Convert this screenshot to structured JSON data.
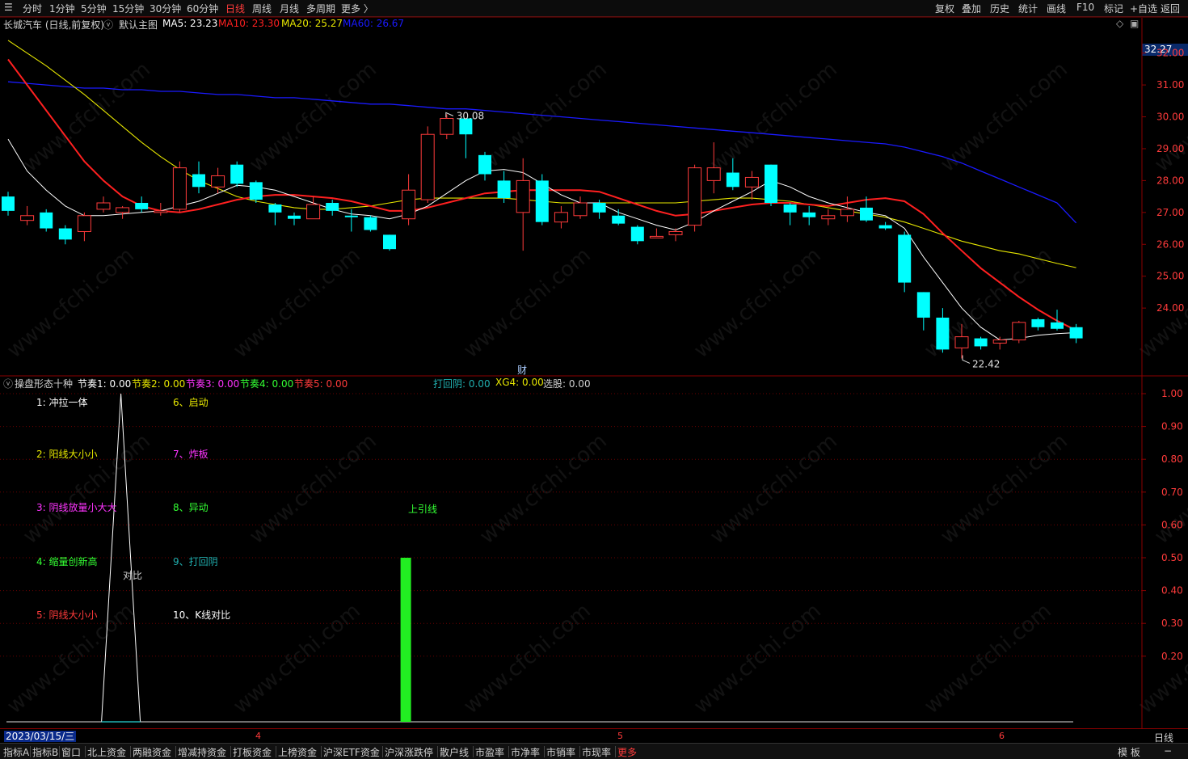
{
  "topbar": {
    "periods": [
      "分时",
      "1分钟",
      "5分钟",
      "15分钟",
      "30分钟",
      "60分钟",
      "日线",
      "周线",
      "月线",
      "多周期",
      "更多 〉"
    ],
    "active_period": "日线",
    "right_buttons": [
      "复权",
      "叠加",
      "历史",
      "统计",
      "画线",
      "F10",
      "标记",
      "+自选",
      "返回"
    ]
  },
  "main_info": {
    "stock": "长城汽车 (日线,前复权)",
    "template": "默认主图",
    "ma5": "MA5: 23.23",
    "ma10": "MA10: 23.30",
    "ma20": "MA20: 25.27",
    "ma60": "MA60: 26.67"
  },
  "colors": {
    "up": "#ff3b3b",
    "down": "#00ffff",
    "ma5": "#ffffff",
    "ma10": "#ff2020",
    "ma20": "#e6e600",
    "ma60": "#1a1aff",
    "axis": "#8b0000"
  },
  "price_axis": {
    "current": "32.27",
    "ticks": [
      "32.00",
      "31.00",
      "30.00",
      "29.00",
      "28.00",
      "27.00",
      "26.00",
      "25.00",
      "24.00"
    ]
  },
  "annotations": {
    "high": "30.08",
    "low": "22.42",
    "event_marker": "财"
  },
  "chart_data": {
    "type": "candlestick",
    "x_labels": [
      "4",
      "5",
      "6"
    ],
    "ylim": [
      22.0,
      32.6
    ],
    "candles": [
      {
        "o": 27.5,
        "c": 27.05,
        "h": 27.65,
        "l": 26.9
      },
      {
        "o": 26.75,
        "c": 26.9,
        "h": 27.2,
        "l": 26.6
      },
      {
        "o": 27.0,
        "c": 26.5,
        "h": 27.1,
        "l": 26.4
      },
      {
        "o": 26.5,
        "c": 26.15,
        "h": 26.6,
        "l": 26.0
      },
      {
        "o": 26.4,
        "c": 26.9,
        "h": 27.0,
        "l": 26.1
      },
      {
        "o": 27.1,
        "c": 27.3,
        "h": 27.5,
        "l": 27.0
      },
      {
        "o": 27.0,
        "c": 27.15,
        "h": 27.2,
        "l": 26.8
      },
      {
        "o": 27.3,
        "c": 27.1,
        "h": 27.5,
        "l": 27.0
      },
      {
        "o": 27.0,
        "c": 27.05,
        "h": 27.3,
        "l": 26.9
      },
      {
        "o": 27.1,
        "c": 28.4,
        "h": 28.6,
        "l": 27.0
      },
      {
        "o": 28.2,
        "c": 27.8,
        "h": 28.6,
        "l": 27.6
      },
      {
        "o": 27.8,
        "c": 28.15,
        "h": 28.4,
        "l": 27.6
      },
      {
        "o": 28.5,
        "c": 27.9,
        "h": 28.6,
        "l": 27.8
      },
      {
        "o": 27.95,
        "c": 27.4,
        "h": 28.0,
        "l": 27.3
      },
      {
        "o": 27.25,
        "c": 27.0,
        "h": 27.3,
        "l": 26.6
      },
      {
        "o": 26.9,
        "c": 26.8,
        "h": 27.0,
        "l": 26.6
      },
      {
        "o": 26.8,
        "c": 27.25,
        "h": 27.5,
        "l": 26.8
      },
      {
        "o": 27.3,
        "c": 27.05,
        "h": 27.4,
        "l": 26.9
      },
      {
        "o": 26.9,
        "c": 26.85,
        "h": 27.1,
        "l": 26.4
      },
      {
        "o": 26.85,
        "c": 26.45,
        "h": 26.9,
        "l": 26.4
      },
      {
        "o": 26.3,
        "c": 25.85,
        "h": 26.3,
        "l": 25.8
      },
      {
        "o": 26.8,
        "c": 27.7,
        "h": 28.2,
        "l": 26.6
      },
      {
        "o": 27.4,
        "c": 29.45,
        "h": 29.7,
        "l": 27.3
      },
      {
        "o": 29.45,
        "c": 29.95,
        "h": 30.08,
        "l": 29.3
      },
      {
        "o": 29.95,
        "c": 29.45,
        "h": 29.95,
        "l": 28.7
      },
      {
        "o": 28.8,
        "c": 28.2,
        "h": 28.9,
        "l": 28.0
      },
      {
        "o": 28.0,
        "c": 27.45,
        "h": 28.3,
        "l": 27.3
      },
      {
        "o": 27.0,
        "c": 28.0,
        "h": 28.7,
        "l": 25.8
      },
      {
        "o": 28.0,
        "c": 26.7,
        "h": 28.2,
        "l": 26.6
      },
      {
        "o": 26.7,
        "c": 27.0,
        "h": 27.2,
        "l": 26.5
      },
      {
        "o": 26.9,
        "c": 27.3,
        "h": 27.5,
        "l": 26.8
      },
      {
        "o": 27.3,
        "c": 27.0,
        "h": 27.4,
        "l": 26.8
      },
      {
        "o": 26.9,
        "c": 26.65,
        "h": 27.1,
        "l": 26.6
      },
      {
        "o": 26.55,
        "c": 26.1,
        "h": 26.6,
        "l": 26.0
      },
      {
        "o": 26.2,
        "c": 26.25,
        "h": 26.5,
        "l": 26.2
      },
      {
        "o": 26.3,
        "c": 26.4,
        "h": 26.5,
        "l": 26.1
      },
      {
        "o": 26.6,
        "c": 28.4,
        "h": 28.5,
        "l": 26.4
      },
      {
        "o": 28.0,
        "c": 28.4,
        "h": 29.2,
        "l": 27.6
      },
      {
        "o": 28.25,
        "c": 27.8,
        "h": 28.7,
        "l": 27.7
      },
      {
        "o": 27.8,
        "c": 28.1,
        "h": 28.3,
        "l": 27.4
      },
      {
        "o": 28.5,
        "c": 27.3,
        "h": 28.5,
        "l": 27.2
      },
      {
        "o": 27.25,
        "c": 27.0,
        "h": 27.3,
        "l": 26.6
      },
      {
        "o": 27.0,
        "c": 26.85,
        "h": 27.2,
        "l": 26.6
      },
      {
        "o": 26.8,
        "c": 26.9,
        "h": 27.1,
        "l": 26.6
      },
      {
        "o": 26.9,
        "c": 27.1,
        "h": 27.5,
        "l": 26.7
      },
      {
        "o": 27.15,
        "c": 26.75,
        "h": 27.5,
        "l": 26.7
      },
      {
        "o": 26.6,
        "c": 26.5,
        "h": 26.7,
        "l": 26.45
      },
      {
        "o": 26.3,
        "c": 24.8,
        "h": 26.4,
        "l": 24.5
      },
      {
        "o": 24.5,
        "c": 23.7,
        "h": 24.5,
        "l": 23.3
      },
      {
        "o": 23.7,
        "c": 22.7,
        "h": 24.0,
        "l": 22.6
      },
      {
        "o": 22.75,
        "c": 23.1,
        "h": 23.5,
        "l": 22.42
      },
      {
        "o": 23.05,
        "c": 22.8,
        "h": 23.1,
        "l": 22.7
      },
      {
        "o": 22.9,
        "c": 23.0,
        "h": 23.1,
        "l": 22.7
      },
      {
        "o": 23.0,
        "c": 23.55,
        "h": 23.6,
        "l": 22.9
      },
      {
        "o": 23.65,
        "c": 23.4,
        "h": 23.7,
        "l": 23.3
      },
      {
        "o": 23.55,
        "c": 23.35,
        "h": 23.95,
        "l": 23.3
      },
      {
        "o": 23.4,
        "c": 23.05,
        "h": 23.5,
        "l": 22.9
      }
    ],
    "ma5": [
      29.3,
      28.3,
      27.7,
      27.2,
      26.9,
      26.9,
      26.95,
      27.0,
      27.05,
      27.2,
      27.35,
      27.6,
      27.85,
      27.8,
      27.7,
      27.5,
      27.3,
      27.1,
      26.95,
      26.9,
      26.8,
      26.95,
      27.2,
      27.6,
      28.0,
      28.3,
      28.35,
      28.25,
      27.9,
      27.55,
      27.3,
      27.3,
      27.0,
      26.8,
      26.6,
      26.45,
      26.7,
      27.05,
      27.35,
      27.65,
      28.0,
      27.8,
      27.5,
      27.3,
      27.15,
      27.0,
      26.9,
      26.5,
      25.6,
      24.8,
      24.0,
      23.4,
      23.0,
      23.05,
      23.15,
      23.2,
      23.23
    ],
    "ma10": [
      31.8,
      31.0,
      30.2,
      29.4,
      28.6,
      28.0,
      27.5,
      27.2,
      27.05,
      27.0,
      27.1,
      27.25,
      27.4,
      27.5,
      27.55,
      27.55,
      27.5,
      27.45,
      27.35,
      27.2,
      27.05,
      27.05,
      27.15,
      27.3,
      27.45,
      27.6,
      27.65,
      27.7,
      27.7,
      27.7,
      27.7,
      27.65,
      27.45,
      27.25,
      27.05,
      26.9,
      26.95,
      27.05,
      27.15,
      27.25,
      27.3,
      27.3,
      27.25,
      27.2,
      27.3,
      27.4,
      27.45,
      27.35,
      26.95,
      26.35,
      25.8,
      25.25,
      24.8,
      24.35,
      23.95,
      23.6,
      23.3
    ],
    "ma20": [
      32.4,
      32.0,
      31.6,
      31.15,
      30.7,
      30.2,
      29.7,
      29.2,
      28.75,
      28.35,
      28.0,
      27.75,
      27.5,
      27.35,
      27.25,
      27.15,
      27.1,
      27.1,
      27.15,
      27.2,
      27.3,
      27.4,
      27.45,
      27.45,
      27.45,
      27.45,
      27.45,
      27.4,
      27.35,
      27.3,
      27.3,
      27.3,
      27.3,
      27.3,
      27.3,
      27.3,
      27.35,
      27.4,
      27.45,
      27.45,
      27.4,
      27.35,
      27.25,
      27.15,
      27.05,
      26.95,
      26.85,
      26.7,
      26.5,
      26.3,
      26.1,
      25.95,
      25.8,
      25.7,
      25.55,
      25.4,
      25.27
    ],
    "ma60": [
      31.1,
      31.05,
      31.0,
      30.95,
      30.9,
      30.9,
      30.85,
      30.85,
      30.8,
      30.8,
      30.75,
      30.7,
      30.7,
      30.65,
      30.6,
      30.6,
      30.55,
      30.5,
      30.45,
      30.4,
      30.4,
      30.35,
      30.3,
      30.25,
      30.25,
      30.2,
      30.15,
      30.1,
      30.05,
      30.0,
      29.95,
      29.9,
      29.85,
      29.8,
      29.75,
      29.7,
      29.65,
      29.6,
      29.55,
      29.5,
      29.45,
      29.4,
      29.35,
      29.3,
      29.25,
      29.2,
      29.15,
      29.05,
      28.9,
      28.75,
      28.55,
      28.3,
      28.05,
      27.8,
      27.55,
      27.3,
      26.67
    ]
  },
  "sub_info": {
    "name": "操盘形态十种",
    "j1": "节奏1: 0.00",
    "j2": "节奏2: 0.00",
    "j3": "节奏3: 0.00",
    "j4": "节奏4: 0.00",
    "j5": "节奏5: 0.00",
    "dhy": "打回阴: 0.00",
    "xg4": "XG4: 0.00",
    "xg": "选股: 0.00"
  },
  "sub_legend": [
    {
      "text": "1: 冲拉一体",
      "color": "#ffffff"
    },
    {
      "text": "2: 阳线大小小",
      "color": "#e6e600"
    },
    {
      "text": "3: 阴线放量小大大",
      "color": "#ff33ff"
    },
    {
      "text": "4: 缩量创新高",
      "color": "#33ff33"
    },
    {
      "text": "5: 阴线大小小",
      "color": "#ff3b3b"
    },
    {
      "text": "6、启动",
      "color": "#e6e600"
    },
    {
      "text": "7、炸板",
      "color": "#ff33ff"
    },
    {
      "text": "8、异动",
      "color": "#33ff33"
    },
    {
      "text": "9、打回阴",
      "color": "#20b0b0"
    },
    {
      "text": "10、K线对比",
      "color": "#ffffff"
    }
  ],
  "sub_labels": {
    "compare": "对比",
    "upper_shadow": "上引线"
  },
  "sub_axis": {
    "ticks": [
      "1.00",
      "0.90",
      "0.80",
      "0.70",
      "0.60",
      "0.50",
      "0.40",
      "0.30",
      "0.20"
    ]
  },
  "sub_chart_data": {
    "type": "indicator",
    "triangle_peak_index": 6,
    "triangle_value": 1.0,
    "bar_index": 21,
    "bar_value": 0.5
  },
  "datebar": {
    "date": "2023/03/15/三",
    "months": [
      "4",
      "5",
      "6"
    ],
    "period": "日线"
  },
  "bottom_tabs": [
    "指标A",
    "指标B",
    "窗口",
    "北上资金",
    "两融资金",
    "增减持资金",
    "打板资金",
    "上榜资金",
    "沪深ETF资金",
    "沪深涨跌停",
    "散户线",
    "市盈率",
    "市净率",
    "市销率",
    "市现率",
    "更多"
  ],
  "bottom_right": [
    "模 板",
    "−"
  ],
  "watermark": "www.cfchi.com"
}
